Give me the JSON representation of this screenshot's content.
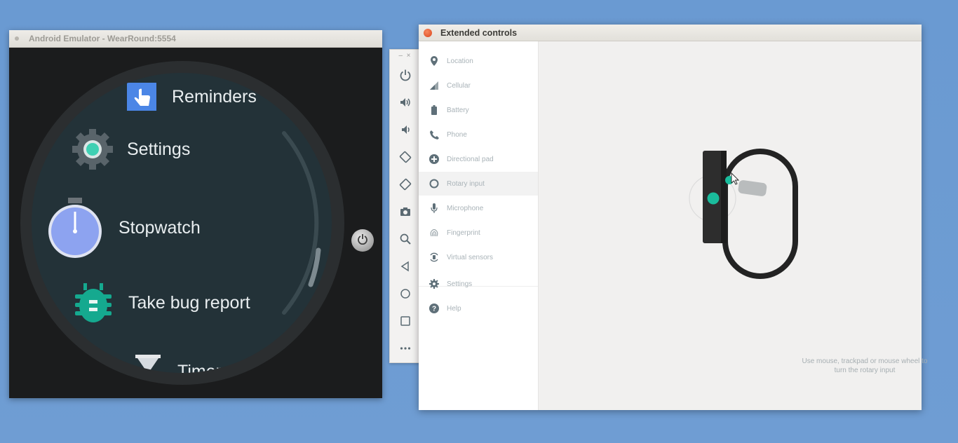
{
  "emulator": {
    "title": "Android Emulator - WearRound:5554",
    "items": [
      {
        "label": "Reminders",
        "icon": "reminders-hand-icon"
      },
      {
        "label": "Settings",
        "icon": "settings-gear-icon"
      },
      {
        "label": "Stopwatch",
        "icon": "stopwatch-icon"
      },
      {
        "label": "Take bug report",
        "icon": "bug-icon"
      },
      {
        "label": "Timer",
        "icon": "hourglass-icon"
      }
    ]
  },
  "toolbar": {
    "buttons": [
      "power-icon",
      "volume-up-icon",
      "volume-down-icon",
      "rotate-left-icon",
      "rotate-right-icon",
      "camera-icon",
      "zoom-icon",
      "back-icon",
      "home-icon",
      "overview-icon",
      "more-icon"
    ]
  },
  "extended": {
    "title": "Extended controls",
    "nav": [
      {
        "label": "Location",
        "icon": "location-pin-icon"
      },
      {
        "label": "Cellular",
        "icon": "cellular-signal-icon"
      },
      {
        "label": "Battery",
        "icon": "battery-icon"
      },
      {
        "label": "Phone",
        "icon": "phone-icon"
      },
      {
        "label": "Directional pad",
        "icon": "dpad-icon"
      },
      {
        "label": "Rotary input",
        "icon": "rotary-icon",
        "active": true
      },
      {
        "label": "Microphone",
        "icon": "microphone-icon"
      },
      {
        "label": "Fingerprint",
        "icon": "fingerprint-icon"
      },
      {
        "label": "Virtual sensors",
        "icon": "virtual-sensors-icon"
      },
      {
        "label": "Settings",
        "icon": "settings-icon"
      },
      {
        "label": "Help",
        "icon": "help-icon"
      }
    ],
    "hint_line1": "Use mouse, trackpad or mouse wheel to",
    "hint_line2": "turn the rotary input"
  },
  "colors": {
    "accent": "#1abc9c",
    "desktop": "#6d9bd1",
    "watch_face": "#233238"
  }
}
